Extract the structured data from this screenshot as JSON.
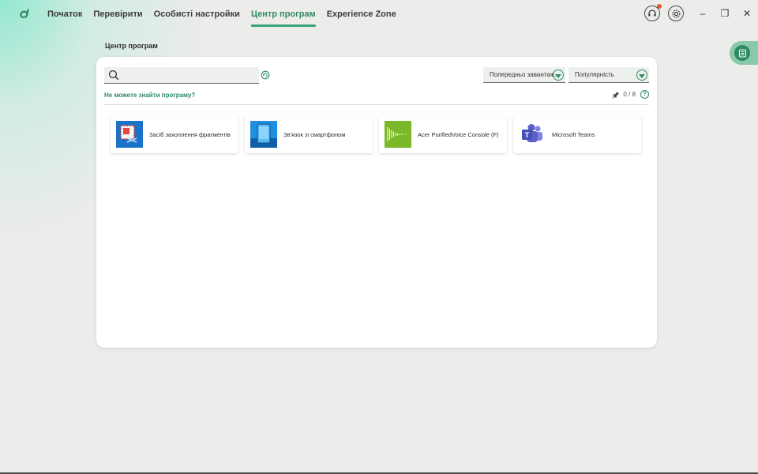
{
  "nav": {
    "items": [
      {
        "label": "Початок",
        "active": false
      },
      {
        "label": "Перевірити",
        "active": false
      },
      {
        "label": "Особисті настройки",
        "active": false
      },
      {
        "label": "Центр програм",
        "active": true
      },
      {
        "label": "Experience Zone",
        "active": false
      }
    ]
  },
  "window": {
    "minimize_glyph": "–",
    "restore_glyph": "❐",
    "close_glyph": "✕"
  },
  "page": {
    "title": "Центр програм"
  },
  "toolbar": {
    "search_value": "",
    "filter_dropdown": "Попередньо завантаж.",
    "sort_dropdown": "Популярність"
  },
  "info": {
    "cant_find_link": "Не можете знайти програму?",
    "pinned_count": "0 / 8",
    "help_glyph": "?"
  },
  "apps": [
    {
      "name": "Засіб захоплення фрагментів",
      "icon": "snipping-tool-icon",
      "color": "#1a73c9"
    },
    {
      "name": "Зв'язок зі смартфоном",
      "icon": "phone-link-icon",
      "color": "#1f8fe0"
    },
    {
      "name": "Acer PurifiedVoice Console (F)",
      "icon": "purified-voice-icon",
      "color": "#7ab829"
    },
    {
      "name": "Microsoft Teams",
      "icon": "teams-icon",
      "color": "#5b5fc7"
    }
  ],
  "colors": {
    "accent": "#2f8a63",
    "accent_light": "#88c9a7"
  }
}
